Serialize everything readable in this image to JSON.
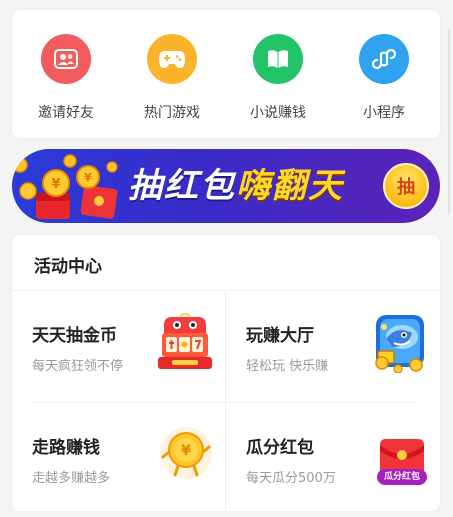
{
  "quick_entries": [
    {
      "label": "邀请好友",
      "icon": "invite-friends-icon",
      "color": "#f25c5c"
    },
    {
      "label": "热门游戏",
      "icon": "gamepad-icon",
      "color": "#fbb32c"
    },
    {
      "label": "小说赚钱",
      "icon": "book-icon",
      "color": "#23c468"
    },
    {
      "label": "小程序",
      "icon": "mini-program-icon",
      "color": "#2fa3f0"
    }
  ],
  "banner": {
    "text_white": "抽红包",
    "text_yellow": "嗨翻天",
    "button_label": "抽"
  },
  "activity_center": {
    "title": "活动中心",
    "items": [
      {
        "name": "天天抽金币",
        "desc": "每天疯狂领不停",
        "icon": "slot-machine-icon"
      },
      {
        "name": "玩赚大厅",
        "desc": "轻松玩 快乐赚",
        "icon": "game-hall-icon"
      },
      {
        "name": "走路赚钱",
        "desc": "走越多赚越多",
        "icon": "walking-coin-icon"
      },
      {
        "name": "瓜分红包",
        "desc": "每天瓜分500万",
        "icon": "red-packet-icon",
        "badge": "瓜分红包"
      }
    ]
  }
}
